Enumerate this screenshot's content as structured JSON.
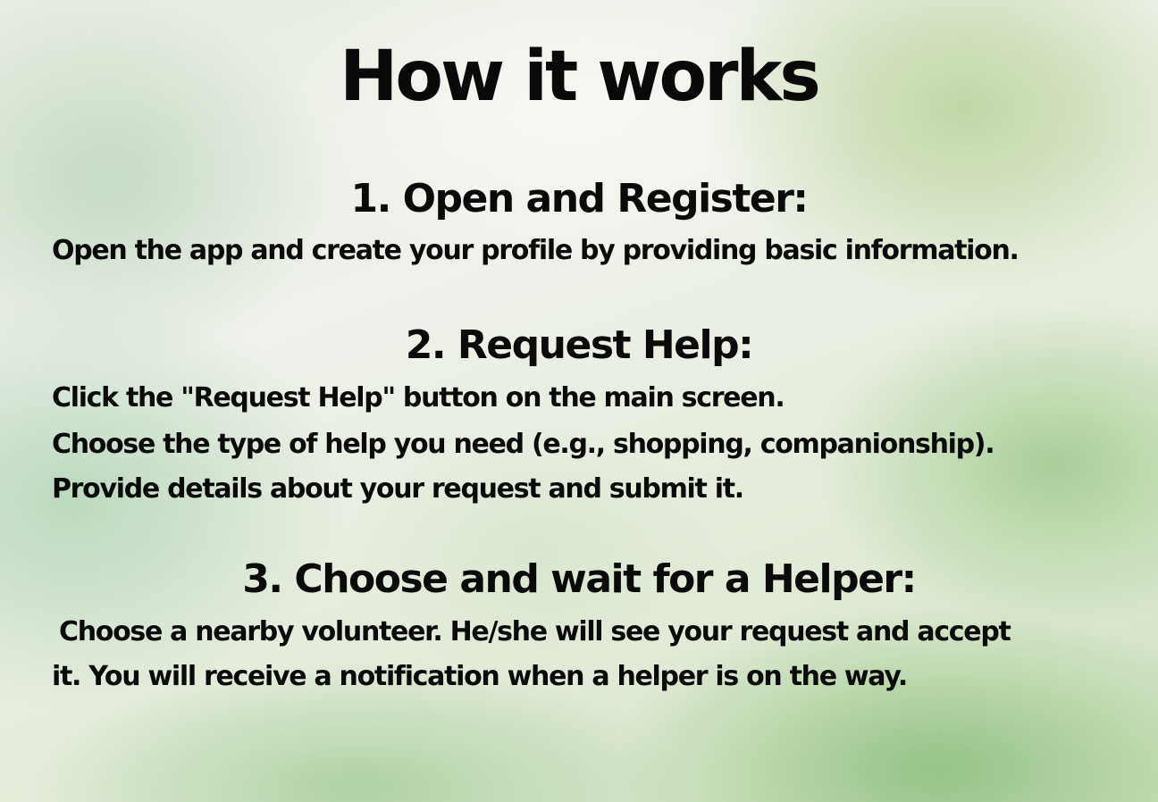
{
  "title": "How it works",
  "steps": [
    {
      "heading": "1. Open and Register:",
      "lines": [
        "Open the app and create your profile by providing basic information."
      ]
    },
    {
      "heading": "2. Request Help:",
      "lines": [
        "Click the \"Request Help\" button on the main screen.",
        "Choose the type of help you need (e.g., shopping, companionship).",
        "Provide details about your request and submit it."
      ]
    },
    {
      "heading": "3. Choose and wait for a Helper:",
      "lines": [
        "Choose a nearby volunteer. He/she will see your request and accept",
        "it. You will receive a notification when a helper is on the way."
      ]
    }
  ]
}
